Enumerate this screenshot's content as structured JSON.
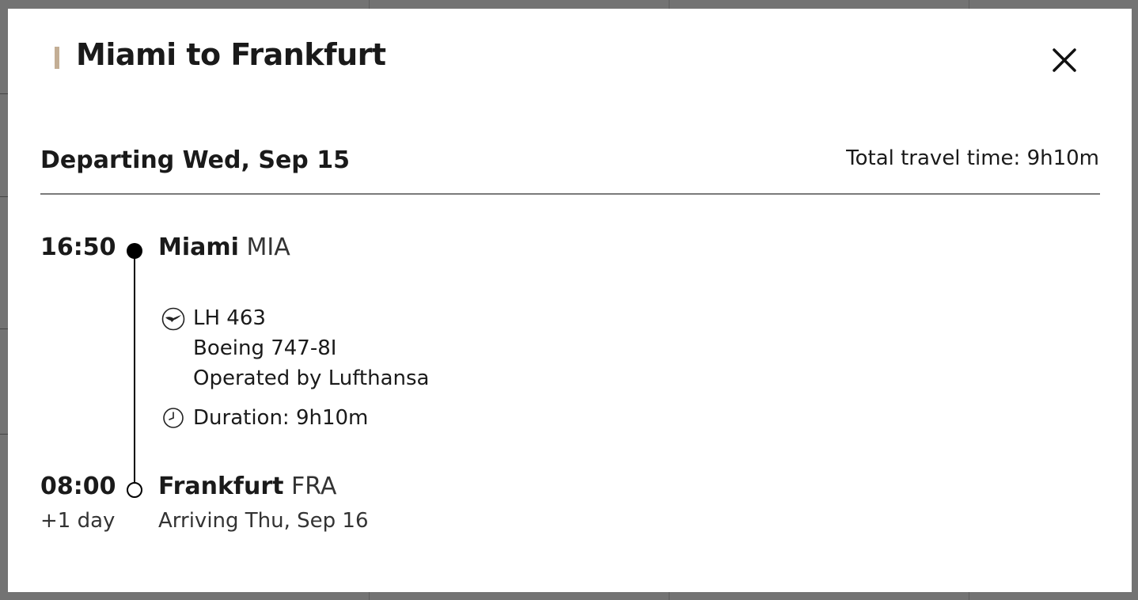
{
  "modal": {
    "title": "Miami to Frankfurt",
    "accent_color": "#c3ae95",
    "close_icon": "close-icon"
  },
  "summary": {
    "departing": "Departing Wed, Sep 15",
    "total_travel_time": "Total travel time: 9h10m"
  },
  "departure": {
    "time": "16:50",
    "city": "Miami",
    "code": "MIA"
  },
  "flight": {
    "number": "LH 463",
    "aircraft": "Boeing 747-8I",
    "operator": "Operated by Lufthansa",
    "duration": "Duration: 9h10m",
    "airline_icon": "lufthansa-crane-icon",
    "duration_icon": "clock-icon"
  },
  "arrival": {
    "time": "08:00",
    "day_offset": "+1 day",
    "city": "Frankfurt",
    "code": "FRA",
    "arriving": "Arriving Thu, Sep 16"
  }
}
